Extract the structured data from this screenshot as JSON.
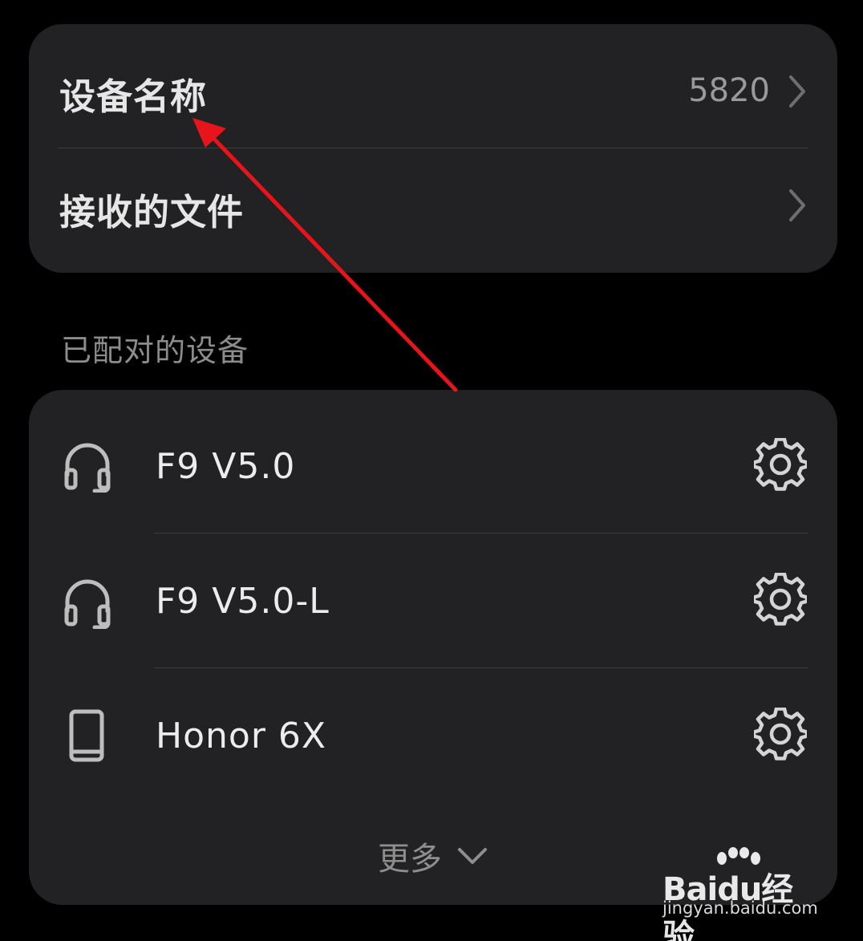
{
  "top_card": {
    "device_name_label": "设备名称",
    "device_name_value": "5820",
    "received_files_label": "接收的文件"
  },
  "paired_section": {
    "title": "已配对的设备"
  },
  "devices": [
    {
      "name": "F9 V5.0",
      "icon": "headphones-icon"
    },
    {
      "name": "F9 V5.0-L",
      "icon": "headphones-icon"
    },
    {
      "name": "Honor 6X",
      "icon": "phone-icon"
    }
  ],
  "more": {
    "label": "更多"
  },
  "annotation": {
    "arrow_color": "#e8141b"
  },
  "watermark": {
    "logo_text": "Baidu经验",
    "url": "jingyan.baidu.com"
  }
}
